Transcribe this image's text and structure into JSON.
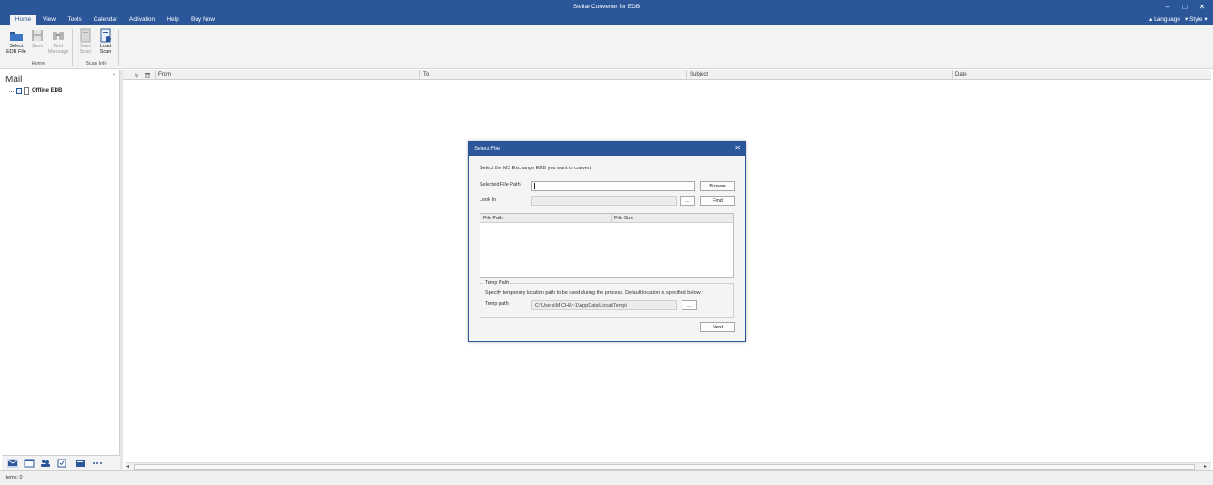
{
  "window": {
    "title": "Stellar Converter for EDB",
    "controls": {
      "minimize": "–",
      "maximize": "□",
      "close": "✕"
    }
  },
  "menu": {
    "tabs": [
      "Home",
      "View",
      "Tools",
      "Calendar",
      "Activation",
      "Help",
      "Buy Now"
    ],
    "active_tab": "Home",
    "language": "Language",
    "style": "Style"
  },
  "ribbon": {
    "buttons": {
      "select_edb": "Select EDB File",
      "save": "Save",
      "find_message": "Find Message",
      "save_scan": "Save Scan",
      "load_scan": "Load Scan"
    },
    "groups": {
      "home": "Home",
      "scan_info": "Scan Info"
    }
  },
  "left_pane": {
    "title": "Mail",
    "collapse_glyph": "‹",
    "tree": [
      {
        "label": "Offline EDB",
        "checked": true
      }
    ]
  },
  "grid": {
    "columns": [
      "From",
      "To",
      "Subject",
      "Date"
    ]
  },
  "status": {
    "items": "Items: 0"
  },
  "dialog": {
    "title": "Select File",
    "close": "✕",
    "instruction": "Select the MS Exchange EDB you want to convert",
    "selected_file_path_label": "Selected File Path",
    "browse": "Browse",
    "look_in_label": "Look In",
    "ellipsis": "...",
    "find": "Find",
    "list_columns": [
      "File Path",
      "File Size"
    ],
    "temp": {
      "group_title": "Temp Path",
      "description": "Specify temporary location path to be used during the process. Default location is specified below :",
      "label": "Temp path",
      "value": "C:\\Users\\MICHA~1\\AppData\\Local\\Temp\\"
    },
    "next": "Next"
  },
  "colors": {
    "accent": "#2b579a",
    "ribbon_bg": "#f3f3f3"
  }
}
